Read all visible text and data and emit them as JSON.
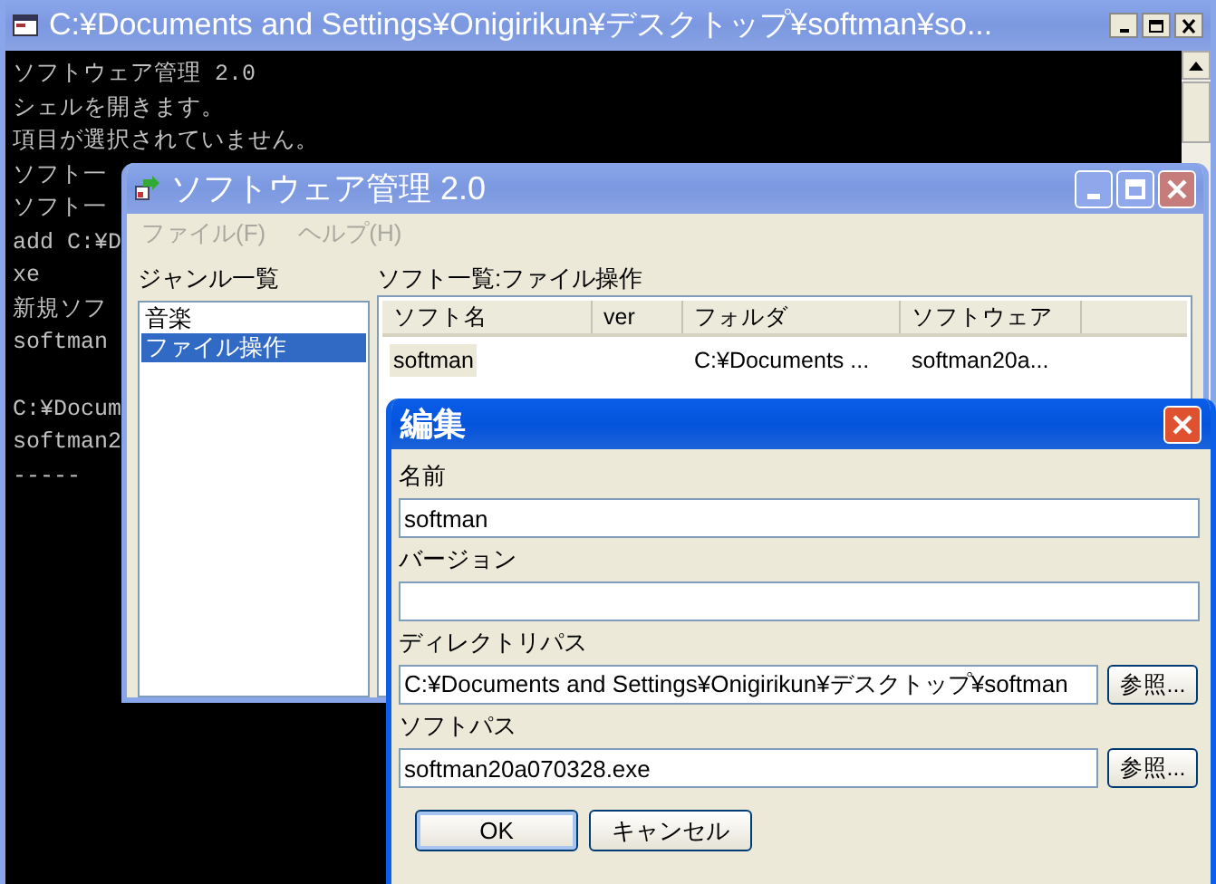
{
  "console_window": {
    "title": "C:¥Documents and Settings¥Onigirikun¥デスクトップ¥softman¥so...",
    "active": false,
    "blocks": [
      [
        "ソフトウェア管理 2.0",
        "シェルを開きます。",
        "項目が選択されていません。",
        "ソフト一",
        "ソフト一",
        "add C:¥D",
        "xe",
        "新規ソフ",
        "softman"
      ],
      [
        "C:¥Docum",
        "softman2",
        "-----"
      ]
    ]
  },
  "app_window": {
    "title": "ソフトウェア管理 2.0",
    "active": false,
    "menu": [
      {
        "label": "ファイル(F)"
      },
      {
        "label": "ヘルプ(H)"
      }
    ],
    "genre_list": {
      "label": "ジャンル一覧",
      "items": [
        {
          "label": "音楽",
          "selected": false
        },
        {
          "label": "ファイル操作",
          "selected": true
        }
      ]
    },
    "software_list": {
      "label": "ソフト一覧:ファイル操作",
      "columns": [
        "ソフト名",
        "ver",
        "フォルダ",
        "ソフトウェア"
      ],
      "rows": [
        {
          "cells": [
            "softman",
            "",
            "C:¥Documents ...",
            "softman20a..."
          ],
          "selected": true
        }
      ]
    }
  },
  "edit_dialog": {
    "title": "編集",
    "active": true,
    "fields": [
      {
        "label": "名前",
        "value": "softman"
      },
      {
        "label": "バージョン"
      },
      {
        "label": "ディレクトリパス",
        "value": "C:¥Documents and Settings¥Onigirikun¥デスクトップ¥softman",
        "button": "参照..."
      },
      {
        "label": "ソフトパス",
        "value": "softman20a070328.exe",
        "button": "参照..."
      }
    ],
    "buttons": [
      {
        "label": "OK",
        "default": true
      },
      {
        "label": "キャンセル",
        "default": false
      }
    ]
  }
}
